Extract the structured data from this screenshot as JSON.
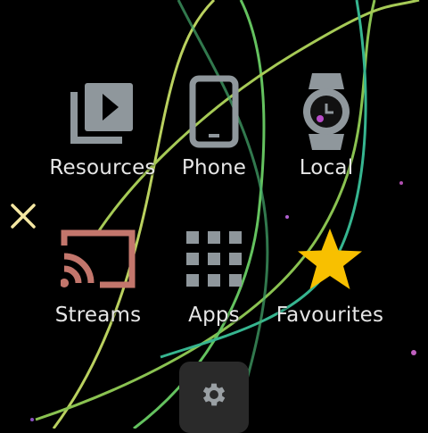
{
  "menu": {
    "items": [
      {
        "label": "Resources",
        "icon": "video-library-icon"
      },
      {
        "label": "Phone",
        "icon": "phone-icon"
      },
      {
        "label": "Local",
        "icon": "watch-icon"
      },
      {
        "label": "Streams",
        "icon": "cast-icon"
      },
      {
        "label": "Apps",
        "icon": "apps-grid-icon"
      },
      {
        "label": "Favourites",
        "icon": "star-icon"
      }
    ]
  },
  "controls": {
    "close_icon": "close-icon",
    "settings_icon": "gear-icon"
  },
  "colors": {
    "background": "#000000",
    "icon_gray": "#8f979c",
    "cast_red": "#c3766c",
    "star_yellow": "#f8c000",
    "close_yellow": "#f4e7a2",
    "settings_bg": "#2a2a2a"
  }
}
